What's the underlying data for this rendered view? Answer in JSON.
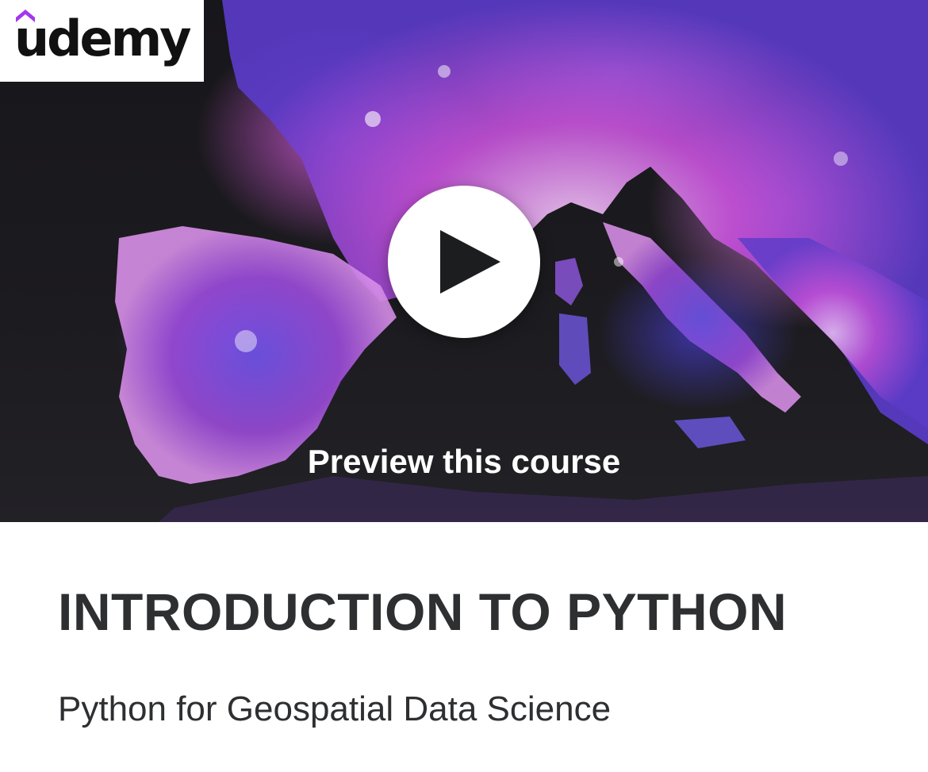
{
  "brand": {
    "logo_text": "udemy",
    "accent_color": "#a435f0"
  },
  "preview": {
    "label": "Preview this course",
    "play_icon": "play-icon"
  },
  "course": {
    "title": "INTRODUCTION TO PYTHON",
    "subtitle": "Python for Geospatial Data Science"
  }
}
